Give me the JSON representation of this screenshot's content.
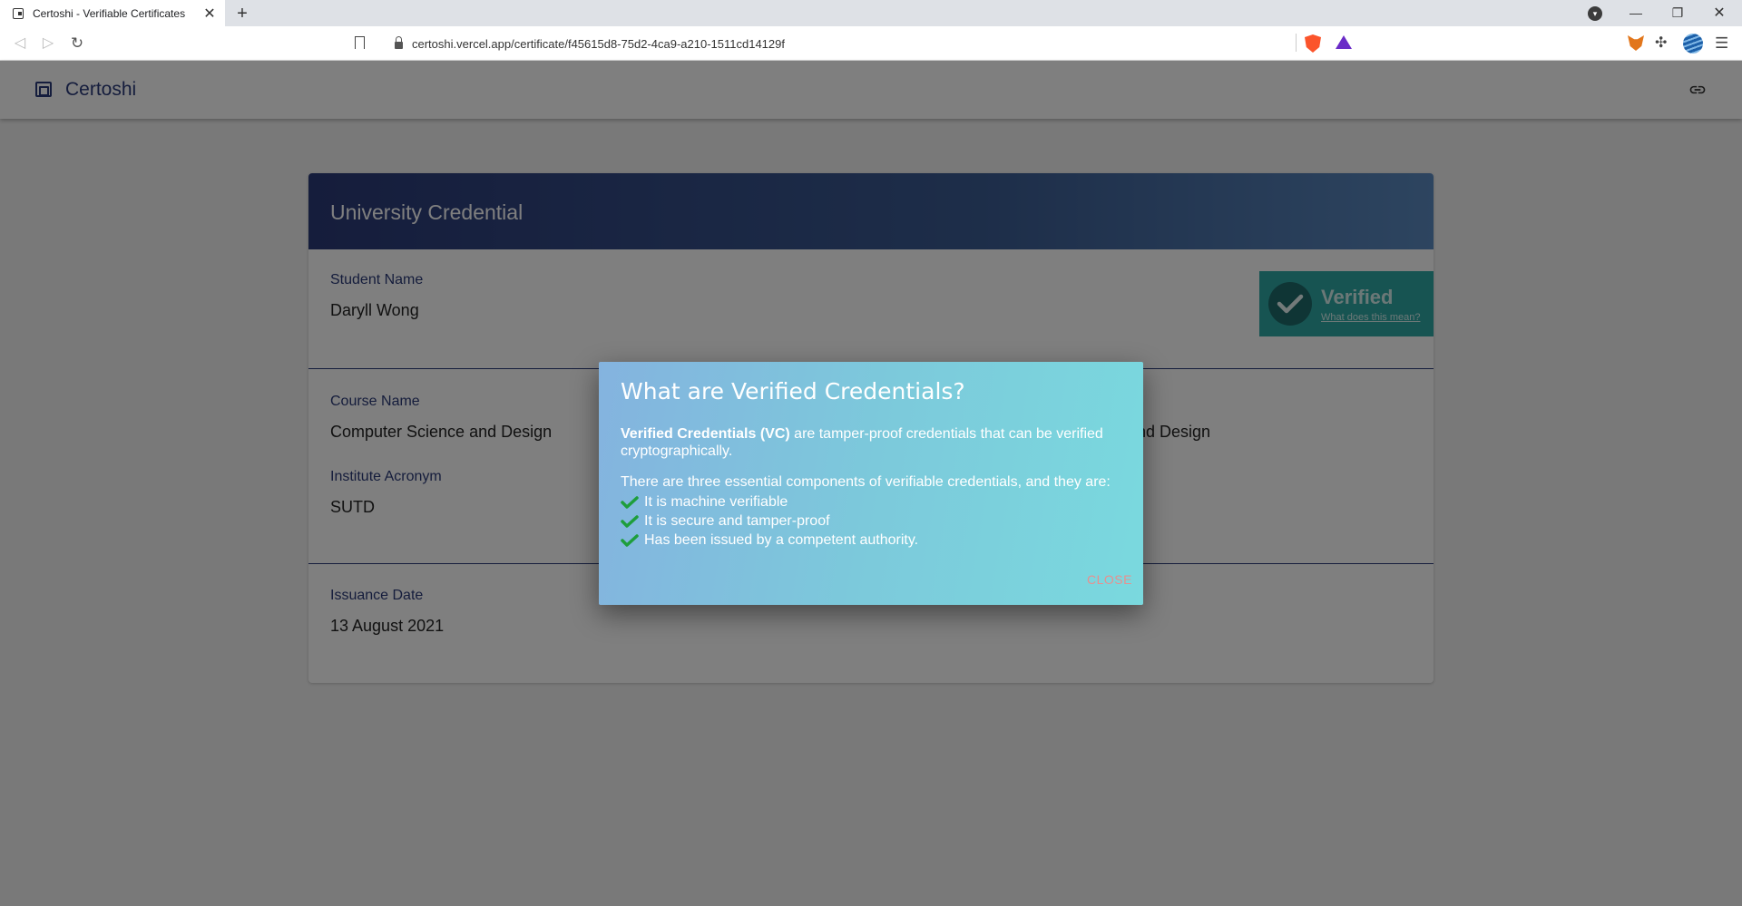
{
  "browser": {
    "tab_title": "Certoshi - Verifiable Certificates",
    "new_tab_label": "+",
    "url": "certoshi.vercel.app/certificate/f45615d8-75d2-4ca9-a210-1511cd14129f"
  },
  "app": {
    "brand_name": "Certoshi"
  },
  "card": {
    "title": "University Credential",
    "fields": {
      "student_name_label": "Student Name",
      "student_name": "Daryll Wong",
      "course_name_label": "Course Name",
      "course_name": "Computer Science and Design",
      "course_name_partial": "nd Design",
      "institute_acronym_label": "Institute Acronym",
      "institute_acronym": "SUTD",
      "issuance_date_label": "Issuance Date",
      "issuance_date": "13 August 2021"
    },
    "verified": {
      "title": "Verified",
      "link": "What does this mean?"
    }
  },
  "dialog": {
    "title": "What are Verified Credentials?",
    "intro_term": "Verified Credentials (VC)",
    "intro_rest": " are tamper-proof credentials that can be verified cryptographically.",
    "components_intro": "There are three essential components of verifiable credentials, and they are:",
    "components": [
      "It is machine verifiable",
      "It is secure and tamper-proof",
      "Has been issued by a competent authority."
    ],
    "close_label": "CLOSE"
  },
  "colors": {
    "brand": "#2a3a7a",
    "header_gradient_start": "#2b3a78",
    "verified_badge": "#2fa9a4",
    "dialog_gradient_start": "#84b3df",
    "dialog_gradient_end": "#7ad9de",
    "check_green": "#1e9e3c",
    "close_text": "#e8908f"
  }
}
